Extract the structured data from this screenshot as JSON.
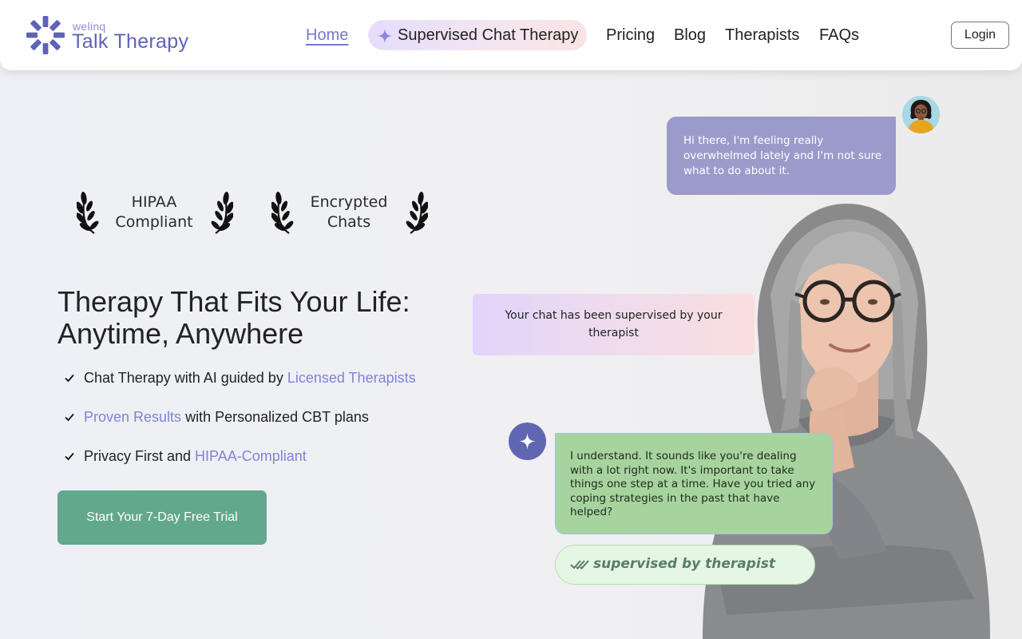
{
  "brand": {
    "small": "welinq",
    "name": "Talk Therapy",
    "color": "#5f63b8"
  },
  "nav": {
    "home": "Home",
    "supervised": "Supervised Chat Therapy",
    "pricing": "Pricing",
    "blog": "Blog",
    "therapists": "Therapists",
    "faqs": "FAQs",
    "login": "Login"
  },
  "badges": [
    {
      "line1": "HIPAA",
      "line2": "Compliant",
      "icon": "laurel-icon"
    },
    {
      "line1": "Encrypted",
      "line2": "Chats",
      "icon": "laurel-icon"
    }
  ],
  "hero": {
    "title_line1": "Therapy That Fits Your Life:",
    "title_line2": "Anytime, Anywhere",
    "features": [
      {
        "pre": "Chat Therapy with AI guided by ",
        "highlight": "Licensed Therapists",
        "post": ""
      },
      {
        "pre": "",
        "highlight": "Proven Results",
        "post": " with Personalized CBT plans"
      },
      {
        "pre": "Privacy First and ",
        "highlight": "HIPAA-Compliant",
        "post": ""
      }
    ],
    "cta": "Start Your 7-Day Free Trial",
    "cta_color": "#62a88d",
    "highlight_color": "#7f84d6"
  },
  "chat": {
    "user_message": "Hi there, I'm feeling really overwhelmed lately and I'm not sure what to do about it.",
    "supervised_notice": "Your chat has been supervised by your therapist",
    "ai_message": "I understand. It sounds like you're dealing with a lot right now. It's important to take things one step at a time. Have you tried any coping strategies in the past that have helped?",
    "supervised_tag": "supervised by therapist",
    "user_bubble_color": "#9b9bcb",
    "ai_bubble_color": "#a7d49e"
  }
}
